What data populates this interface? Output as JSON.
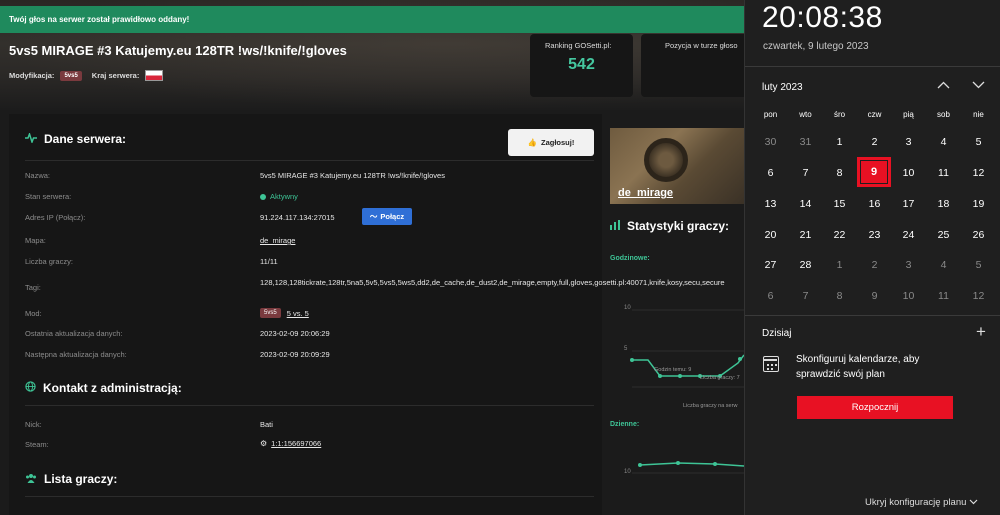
{
  "alert": {
    "text": "Twój głos na serwer został prawidłowo oddany!"
  },
  "server": {
    "title": "5vs5 MIRAGE #3 Katujemy.eu 128TR !ws/!knife/!gloves",
    "mod_label": "Modyfikacja:",
    "mod_tag": "5vs5",
    "country_label": "Kraj serwera:"
  },
  "stats": {
    "ranking_label": "Ranking GOSetti.pl:",
    "ranking_value": "542",
    "position_label": "Pozycja w turze głoso"
  },
  "details": {
    "title": "Dane serwera:",
    "vote_label": "Zagłosuj!",
    "connect_label": "Połącz",
    "rows": [
      {
        "label": "Nazwa:",
        "value": "5vs5 MIRAGE #3 Katujemy.eu 128TR !ws/!knife/!gloves"
      },
      {
        "label": "Stan serwera:",
        "value": "Aktywny"
      },
      {
        "label": "Adres IP (Połącz):",
        "value": "91.224.117.134:27015"
      },
      {
        "label": "Mapa:",
        "value": "de_mirage"
      },
      {
        "label": "Liczba graczy:",
        "value": "11/11"
      },
      {
        "label": "Tagi:",
        "value": "128,128,128tickrate,128tr,5na5,5v5,5vs5,5ws5,dd2,de_cache,de_dust2,de_mirage,empty,full,gloves,gosetti.pl:40071,knife,kosy,secu,secure"
      },
      {
        "label": "Mod:",
        "value": "5 vs. 5",
        "tag": "5vs5"
      },
      {
        "label": "Ostatnia aktualizacja danych:",
        "value": "2023-02-09 20:06:29"
      },
      {
        "label": "Następna aktualizacja danych:",
        "value": "2023-02-09 20:09:29"
      }
    ]
  },
  "admin": {
    "title": "Kontakt z administracją:",
    "rows": [
      {
        "label": "Nick:",
        "value": "Bati"
      },
      {
        "label": "Steam:",
        "value": "1:1:156697066"
      }
    ]
  },
  "players": {
    "title": "Lista graczy:"
  },
  "sidebar": {
    "map_name": "de_mirage",
    "stats_title": "Statystyki graczy:",
    "hourly_label": "Godzinowe:",
    "daily_label": "Dzienne:",
    "tick_10": "10",
    "tick_5": "5",
    "tick_10b": "10",
    "note1": "Godzin temu: 9",
    "note2": "Liczba graczy: 7",
    "xlabel": "Liczba graczy na serw"
  },
  "calendar": {
    "time": "20:08:38",
    "date": "czwartek, 9 lutego 2023",
    "month": "luty 2023",
    "weekdays": [
      "pon",
      "wto",
      "śro",
      "czw",
      "pią",
      "sob",
      "nie"
    ],
    "days": [
      [
        "30",
        "31",
        "1",
        "2",
        "3",
        "4",
        "5"
      ],
      [
        "6",
        "7",
        "8",
        "9",
        "10",
        "11",
        "12"
      ],
      [
        "13",
        "14",
        "15",
        "16",
        "17",
        "18",
        "19"
      ],
      [
        "20",
        "21",
        "22",
        "23",
        "24",
        "25",
        "26"
      ],
      [
        "27",
        "28",
        "1",
        "2",
        "3",
        "4",
        "5"
      ],
      [
        "6",
        "7",
        "8",
        "9",
        "10",
        "11",
        "12"
      ]
    ],
    "today": "9",
    "agenda_title": "Dzisiaj",
    "agenda_text": "Skonfiguruj kalendarze, aby sprawdzić swój plan",
    "start_label": "Rozpocznij",
    "hide_label": "Ukryj konfigurację planu"
  }
}
